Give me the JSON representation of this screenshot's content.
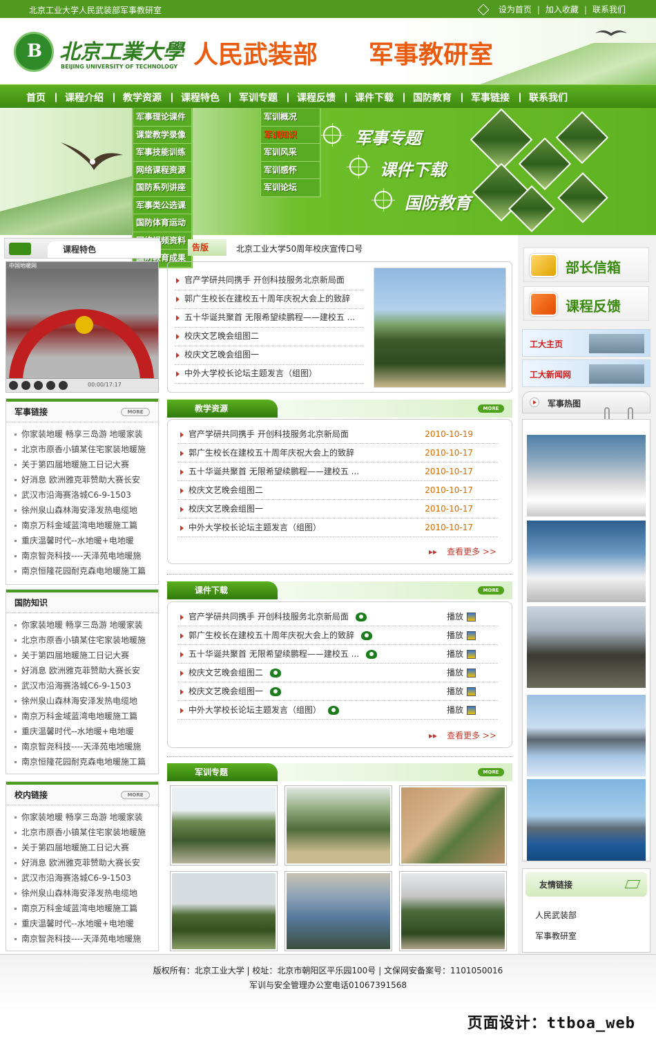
{
  "topbar": {
    "site_name": "北京工业大学人民武装部军事教研室",
    "set_home": "设为首页",
    "sep1": "|",
    "add_fav": "加入收藏",
    "sep2": "|",
    "contact": "联系我们"
  },
  "header": {
    "logo_cn": "北京工業大學",
    "logo_en": "BEIJING UNIVERSITY OF TECHNOLOGY",
    "title1": "人民武装部",
    "title2": "军事教研室"
  },
  "nav": [
    "首页",
    "课程介绍",
    "教学资源",
    "课程特色",
    "军训专题",
    "课程反馈",
    "课件下载",
    "国防教育",
    "军事链接",
    "联系我们"
  ],
  "dropdown_resources": [
    "军事理论课件",
    "课堂教学录像",
    "军事技能训练",
    "网络课程资源",
    "国防系列讲座",
    "军事类公选课",
    "国防体育运动",
    "网络视频资料",
    "国防教育成果"
  ],
  "dropdown_training": {
    "items": [
      "军训概况",
      "军训知识",
      "军训风采",
      "军训感怀",
      "军训论坛"
    ],
    "active_index": 1
  },
  "banner": {
    "line1": "军事专题",
    "line2": "课件下载",
    "line3": "国防教育"
  },
  "course_feature": {
    "title": "课程特色",
    "video_top_label": "中国地暖网",
    "video_time": "00:00/17:17"
  },
  "announcement": {
    "label": "告版",
    "text": "北京工业大学50周年校庆宣传口号"
  },
  "news": [
    "官产学研共同携手 开创科技服务北京新局面",
    "郭广生校长在建校五十周年庆祝大会上的致辞",
    "五十华诞共聚首 无限希望续鹏程——建校五 ...",
    "校庆文艺晚会组图二",
    "校庆文艺晚会组图一",
    "中外大学校长论坛主题发言（组图）"
  ],
  "teaching": {
    "title": "教学资源",
    "more_pill": "MORE",
    "items": [
      {
        "title": "官产学研共同携手 开创科技服务北京新局面",
        "date": "2010-10-19"
      },
      {
        "title": "郭广生校长在建校五十周年庆祝大会上的致辞",
        "date": "2010-10-17"
      },
      {
        "title": "五十华诞共聚首 无限希望续鹏程——建校五 ...",
        "date": "2010-10-17"
      },
      {
        "title": "校庆文艺晚会组图二",
        "date": "2010-10-17"
      },
      {
        "title": "校庆文艺晚会组图一",
        "date": "2010-10-17"
      },
      {
        "title": "中外大学校长论坛主题发言（组图）",
        "date": "2010-10-17"
      }
    ],
    "more_text": "查看更多 >>"
  },
  "courseware": {
    "title": "课件下载",
    "more_pill": "MORE",
    "play_label": "播放",
    "items": [
      "官产学研共同携手 开创科技服务北京新局面",
      "郭广生校长在建校五十周年庆祝大会上的致辞",
      "五十华诞共聚首 无限希望续鹏程——建校五 ...",
      "校庆文艺晚会组图二",
      "校庆文艺晚会组图一",
      "中外大学校长论坛主题发言（组图）"
    ],
    "more_text": "查看更多 >>"
  },
  "training_topic": {
    "title": "军训专题",
    "more_pill": "MORE"
  },
  "military_links": {
    "title": "军事链接",
    "more_pill": "MORE",
    "items": [
      "你家装地暖 畅享三岛游 地暖家装",
      "北京市原香小镇某住宅家装地暖施",
      "关于第四届地暖施工日记大赛",
      "好消息 欧洲雅克菲赞助大赛长安",
      "武汉市沿海赛洛城C6-9-1503",
      "徐州泉山森林海安泽发热电缆地",
      "南京万科金域蓝湾电地暖施工篇",
      "重庆温馨时代--水地暖+电地暖",
      "南京智尧科技----天泽苑电地暖施",
      "南京恒隆花园耐克森电地暖施工篇"
    ]
  },
  "defense_knowledge": {
    "title": "国防知识",
    "items": [
      "你家装地暖 畅享三岛游 地暖家装",
      "北京市原香小镇某住宅家装地暖施",
      "关于第四届地暖施工日记大赛",
      "好消息 欧洲雅克菲赞助大赛长安",
      "武汉市沿海赛洛城C6-9-1503",
      "徐州泉山森林海安泽发热电缆地",
      "南京万科金域蓝湾电地暖施工篇",
      "重庆温馨时代--水地暖+电地暖",
      "南京智尧科技----天泽苑电地暖施",
      "南京恒隆花园耐克森电地暖施工篇"
    ]
  },
  "campus_links": {
    "title": "校内链接",
    "more_pill": "MORE",
    "items": [
      "你家装地暖 畅享三岛游 地暖家装",
      "北京市原香小镇某住宅家装地暖施",
      "关于第四届地暖施工日记大赛",
      "好消息 欧洲雅克菲赞助大赛长安",
      "武汉市沿海赛洛城C6-9-1503",
      "徐州泉山森林海安泽发热电缆地",
      "南京万科金域蓝湾电地暖施工篇",
      "重庆温馨时代--水地暖+电地暖",
      "南京智尧科技----天泽苑电地暖施"
    ]
  },
  "right": {
    "mailbox": "部长信箱",
    "feedback": "课程反馈",
    "link1": "工大主页",
    "link2": "工大新闻网",
    "hot_title": "军事热图",
    "friend_title": "友情链接",
    "friends": [
      "人民武装部",
      "军事教研室"
    ]
  },
  "footer": {
    "line1": "版权所有：北京工业大学 | 校址：北京市朝阳区平乐园100号 | 文保网安备案号：1101050016",
    "line2": "军训与安全管理办公室电话01067391568",
    "designer": "页面设计：ttboa_web"
  },
  "colors": {
    "brand_green": "#4c9a1e",
    "title_orange": "#e95c10",
    "date_orange": "#d46a00",
    "bullet_red": "#c0392b"
  }
}
